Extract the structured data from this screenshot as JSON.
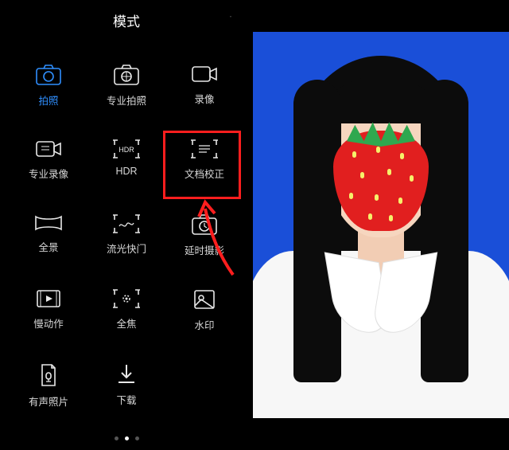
{
  "header": {
    "title": "模式"
  },
  "modes": [
    {
      "id": "photo",
      "label": "拍照",
      "active": true
    },
    {
      "id": "pro-photo",
      "label": "专业拍照",
      "active": false
    },
    {
      "id": "video",
      "label": "录像",
      "active": false
    },
    {
      "id": "pro-video",
      "label": "专业录像",
      "active": false
    },
    {
      "id": "hdr",
      "label": "HDR",
      "active": false
    },
    {
      "id": "doc-correct",
      "label": "文档校正",
      "active": false,
      "highlighted": true
    },
    {
      "id": "panorama",
      "label": "全景",
      "active": false
    },
    {
      "id": "light-paint",
      "label": "流光快门",
      "active": false
    },
    {
      "id": "timelapse",
      "label": "延时摄影",
      "active": false
    },
    {
      "id": "slowmo",
      "label": "慢动作",
      "active": false
    },
    {
      "id": "all-focus",
      "label": "全焦",
      "active": false
    },
    {
      "id": "watermark",
      "label": "水印",
      "active": false
    },
    {
      "id": "audio-photo",
      "label": "有声照片",
      "active": false
    },
    {
      "id": "download",
      "label": "下载",
      "active": false
    }
  ],
  "page_indicator": {
    "count": 3,
    "current": 1
  },
  "colors": {
    "accent": "#2f8fff",
    "highlight": "#ff1e1e",
    "portrait_bg": "#1a4fd8"
  }
}
